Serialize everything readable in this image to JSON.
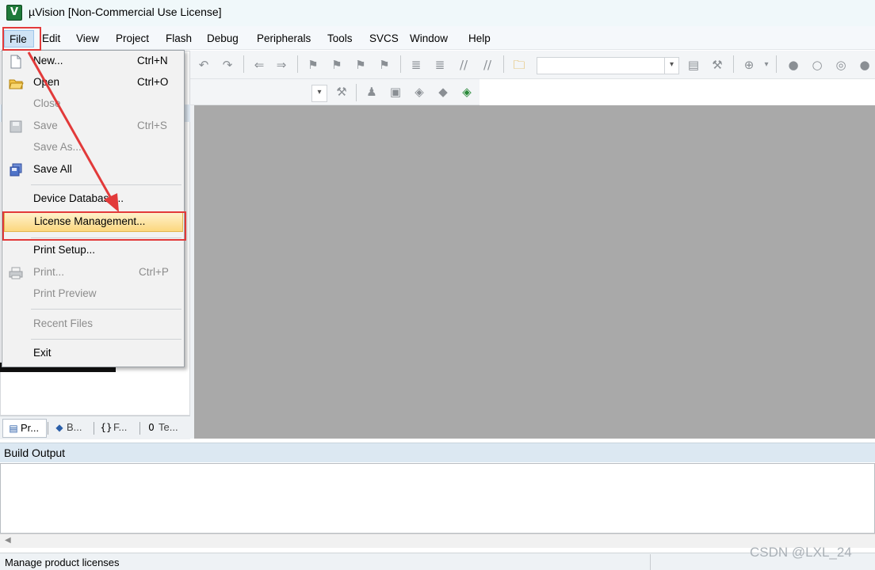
{
  "window": {
    "title": "µVision  [Non-Commercial Use License]",
    "logo_text": "V"
  },
  "menubar": {
    "items": [
      {
        "id": "file",
        "label": "File"
      },
      {
        "id": "edit",
        "label": "Edit"
      },
      {
        "id": "view",
        "label": "View"
      },
      {
        "id": "project",
        "label": "Project"
      },
      {
        "id": "flash",
        "label": "Flash"
      },
      {
        "id": "debug",
        "label": "Debug"
      },
      {
        "id": "peripherals",
        "label": "Peripherals"
      },
      {
        "id": "tools",
        "label": "Tools"
      },
      {
        "id": "svcs",
        "label": "SVCS"
      },
      {
        "id": "window",
        "label": "Window"
      },
      {
        "id": "help",
        "label": "Help"
      }
    ]
  },
  "file_menu": {
    "items": [
      {
        "label": "New...",
        "shortcut": "Ctrl+N",
        "enabled": true,
        "icon": "new-file-icon"
      },
      {
        "label": "Open",
        "shortcut": "Ctrl+O",
        "enabled": true,
        "icon": "open-folder-icon"
      },
      {
        "label": "Close",
        "shortcut": "",
        "enabled": false,
        "icon": ""
      },
      {
        "label": "Save",
        "shortcut": "Ctrl+S",
        "enabled": false,
        "icon": "save-icon"
      },
      {
        "label": "Save As...",
        "shortcut": "",
        "enabled": false,
        "icon": ""
      },
      {
        "label": "Save All",
        "shortcut": "",
        "enabled": true,
        "icon": "save-all-icon"
      },
      {
        "label": "Device Database...",
        "shortcut": "",
        "enabled": true,
        "icon": ""
      },
      {
        "label": "License Management...",
        "shortcut": "",
        "enabled": true,
        "icon": "",
        "highlighted": true
      },
      {
        "label": "Print Setup...",
        "shortcut": "",
        "enabled": true,
        "icon": ""
      },
      {
        "label": "Print...",
        "shortcut": "Ctrl+P",
        "enabled": false,
        "icon": "print-icon"
      },
      {
        "label": "Print Preview",
        "shortcut": "",
        "enabled": false,
        "icon": ""
      },
      {
        "label": "Recent Files",
        "shortcut": "",
        "enabled": false,
        "icon": ""
      },
      {
        "label": "Exit",
        "shortcut": "",
        "enabled": true,
        "icon": ""
      }
    ]
  },
  "panel_tabs": [
    {
      "label": "Pr...",
      "icon": "project-icon",
      "active": true
    },
    {
      "label": "B...",
      "icon": "books-icon",
      "active": false
    },
    {
      "label": "F...",
      "icon": "functions-icon",
      "active": false
    },
    {
      "label": "Te...",
      "icon": "templates-icon",
      "active": false
    }
  ],
  "build_output": {
    "title": "Build Output"
  },
  "statusbar": {
    "text": "Manage product licenses"
  },
  "watermark": "CSDN @LXL_24",
  "colors": {
    "annotation": "#e23a3a",
    "editor_background": "#a9a9a9",
    "menu_highlight": "#fbd77e"
  }
}
